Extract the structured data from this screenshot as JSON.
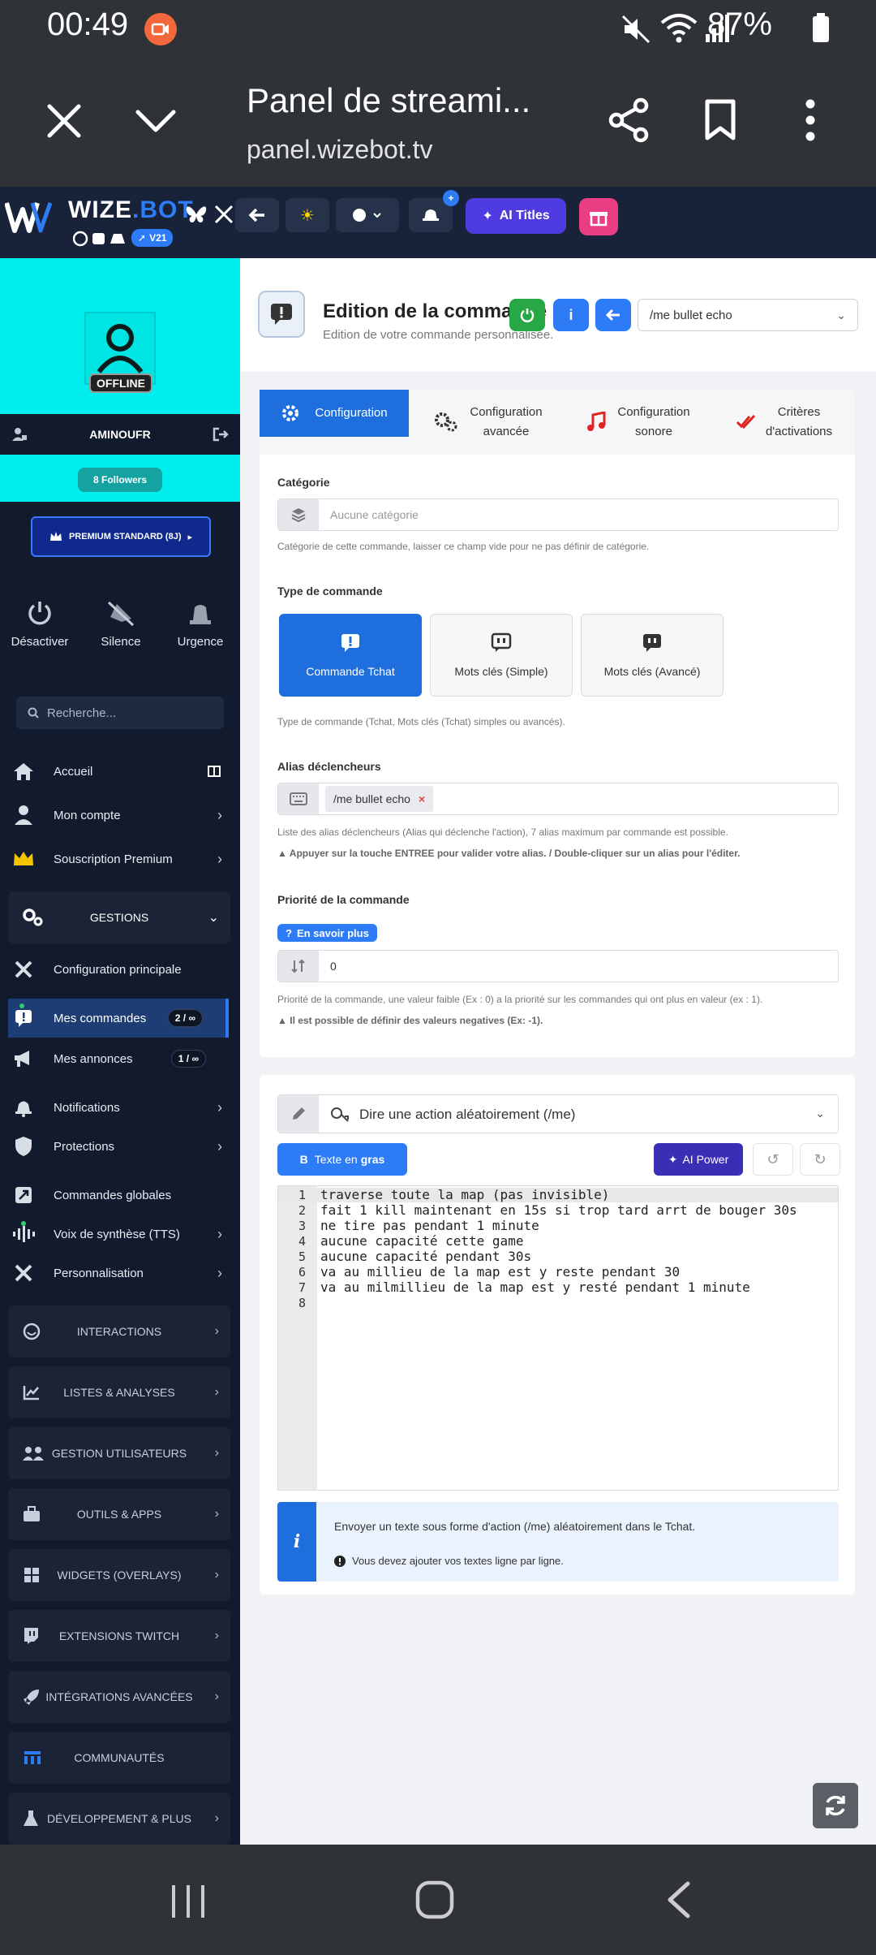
{
  "status_bar": {
    "time": "00:49",
    "battery": "87%"
  },
  "browser": {
    "title": "Panel de streami...",
    "url": "panel.wizebot.tv"
  },
  "topbar": {
    "brand_wize": "WIZE",
    "brand_dot": ".",
    "brand_bot": "BOT",
    "version": "V21",
    "ai_titles_label": "AI Titles"
  },
  "profile": {
    "status": "OFFLINE",
    "username": "AMINOUFR",
    "followers": "8 Followers",
    "premium": "PREMIUM STANDARD (8J)"
  },
  "quick_actions": [
    {
      "label": "Désactiver"
    },
    {
      "label": "Silence"
    },
    {
      "label": "Urgence"
    }
  ],
  "search": {
    "placeholder": "Recherche..."
  },
  "nav": {
    "accueil": "Accueil",
    "mon_compte": "Mon compte",
    "souscription": "Souscription Premium",
    "gestions": "GESTIONS",
    "config_principale": "Configuration principale",
    "mes_commandes": "Mes commandes",
    "mes_commandes_count": "2 / ∞",
    "mes_annonces": "Mes annonces",
    "mes_annonces_count": "1 / ∞",
    "notifications": "Notifications",
    "protections": "Protections",
    "commandes_globales": "Commandes globales",
    "voix_synthese": "Voix de synthèse (TTS)",
    "personnalisation": "Personnalisation",
    "sections": [
      "INTERACTIONS",
      "LISTES & ANALYSES",
      "GESTION UTILISATEURS",
      "OUTILS & APPS",
      "WIDGETS (OVERLAYS)",
      "EXTENSIONS TWITCH",
      "INTÉGRATIONS AVANCÉES",
      "COMMUNAUTÉS",
      "DÉVELOPPEMENT & PLUS"
    ]
  },
  "header": {
    "title": "Edition de la commande",
    "subtitle": "Edition de votre commande personnalisée.",
    "selected_command": "/me bullet echo",
    "info_btn": "i"
  },
  "tabs": [
    {
      "line1": "Configuration",
      "line2": ""
    },
    {
      "line1": "Configuration",
      "line2": "avancée"
    },
    {
      "line1": "Configuration",
      "line2": "sonore"
    },
    {
      "line1": "Critères",
      "line2": "d'activations"
    }
  ],
  "form": {
    "categorie_label": "Catégorie",
    "categorie_placeholder": "Aucune catégorie",
    "categorie_help": "Catégorie de cette commande, laisser ce champ vide pour ne pas définir de catégorie.",
    "type_label": "Type de commande",
    "types": [
      {
        "label": "Commande Tchat"
      },
      {
        "label": "Mots clés (Simple)"
      },
      {
        "label": "Mots clés (Avancé)"
      }
    ],
    "type_help": "Type de commande (Tchat, Mots clés (Tchat) simples ou avancés).",
    "alias_label": "Alias déclencheurs",
    "alias_tag": "/me bullet echo",
    "alias_tag_remove": "×",
    "alias_help": "Liste des alias déclencheurs (Alias qui déclenche l'action), 7 alias maximum par commande est possible.",
    "alias_warn": "Appuyer sur la touche ENTREE pour valider votre alias. / Double-cliquer sur un alias pour l'éditer.",
    "priorite_label": "Priorité de la commande",
    "learn_more": "En savoir plus",
    "priorite_value": "0",
    "priorite_help": "Priorité de la commande, une valeur faible (Ex : 0) a la priorité sur les commandes qui ont plus en valeur (ex : 1).",
    "priorite_warn": "Il est possible de définir des valeurs negatives (Ex: -1)."
  },
  "action": {
    "select_label": "Dire une action aléatoirement (/me)",
    "bold_label_a": "Texte en",
    "bold_label_b": "gras",
    "bold_prefix": "B",
    "ai_power": "AI Power",
    "lines": [
      "traverse toute la map (pas invisible)",
      "fait 1 kill maintenant en 15s si trop tard arrt de bouger 30s",
      "ne tire pas pendant 1 minute",
      "aucune capacité cette game",
      "aucune capacité pendant 30s",
      "va au millieu de la map est y reste pendant 30",
      "va au milmillieu de la map est y resté pendant 1 minute",
      ""
    ],
    "line_numbers": [
      "1",
      "2",
      "3",
      "4",
      "5",
      "6",
      "7",
      "8"
    ],
    "info_text": "Envoyer un texte sous forme d'action (/me) aléatoirement dans le Tchat.",
    "info_warn": "Vous devez ajouter vos textes ligne par ligne."
  },
  "colors": {
    "primary": "#1e6fdd",
    "sidebar": "#121b2d",
    "profile_bg": "#00eeee",
    "ai_purple": "#4f3ce0",
    "gift_pink": "#ea3d84"
  }
}
